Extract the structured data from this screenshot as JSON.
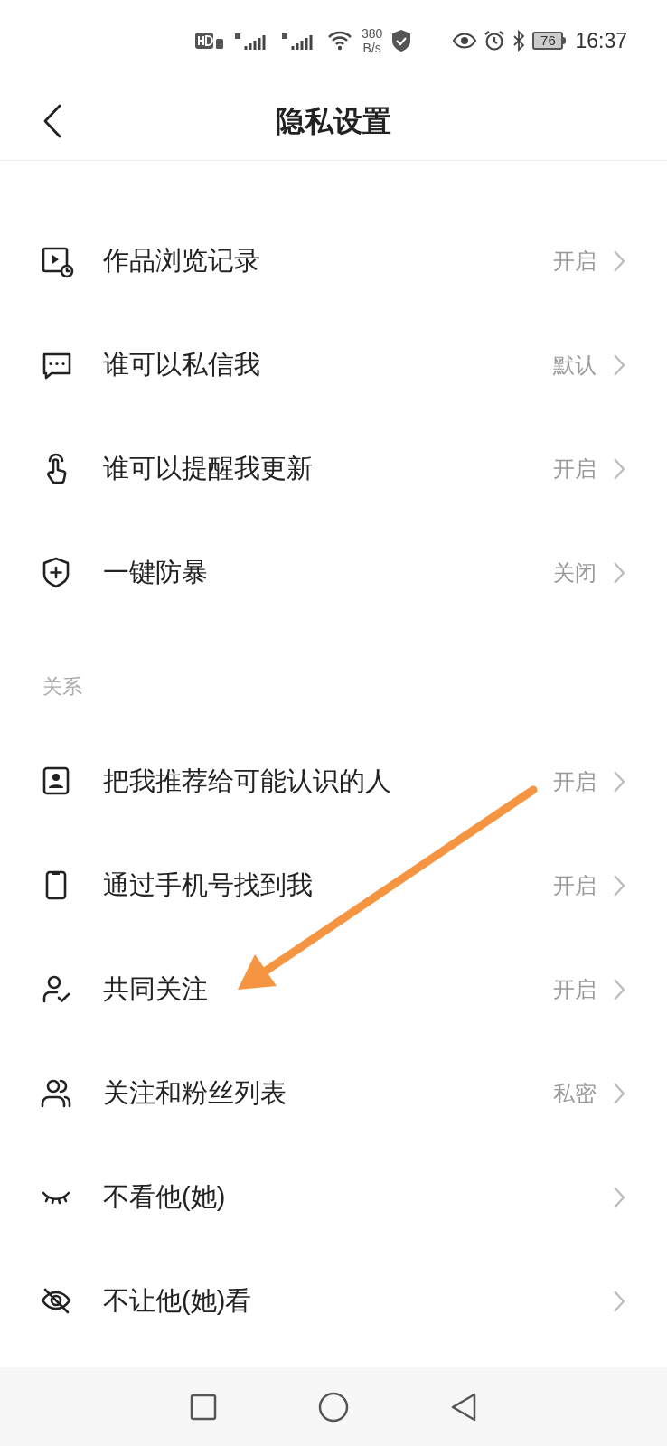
{
  "status_bar": {
    "speed": "380",
    "speed_unit": "B/s",
    "battery": "76",
    "time": "16:37"
  },
  "header": {
    "title": "隐私设置"
  },
  "sections": [
    {
      "items": [
        {
          "label": "作品浏览记录",
          "value": "开启"
        },
        {
          "label": "谁可以私信我",
          "value": "默认"
        },
        {
          "label": "谁可以提醒我更新",
          "value": "开启"
        },
        {
          "label": "一键防暴",
          "value": "关闭"
        }
      ]
    },
    {
      "title": "关系",
      "items": [
        {
          "label": "把我推荐给可能认识的人",
          "value": "开启"
        },
        {
          "label": "通过手机号找到我",
          "value": "开启"
        },
        {
          "label": "共同关注",
          "value": "开启"
        },
        {
          "label": "关注和粉丝列表",
          "value": "私密"
        },
        {
          "label": "不看他(她)"
        },
        {
          "label": "不让他(她)看"
        }
      ]
    }
  ]
}
